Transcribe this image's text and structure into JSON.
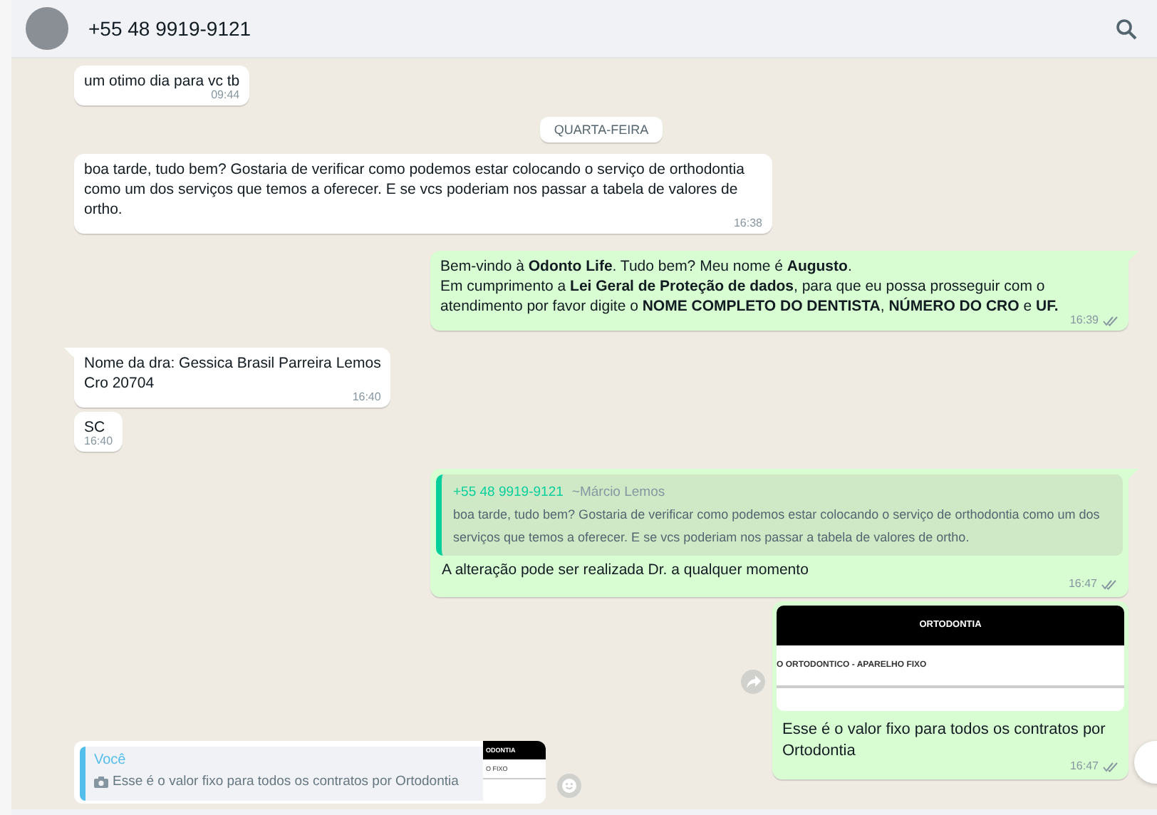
{
  "header": {
    "contact": "+55 48 9919-9121"
  },
  "messages": [
    {
      "kind": "text",
      "outgoing": false,
      "text": "um otimo dia para vc tb",
      "time": "09:44",
      "tail": false
    },
    {
      "kind": "date",
      "text": "QUARTA-FEIRA"
    },
    {
      "kind": "text",
      "outgoing": false,
      "text": "boa tarde, tudo bem? Gostaria de verificar como podemos estar colocando o serviço de orthodontia como um dos serviços que temos a oferecer. E se vcs poderiam nos passar a tabela de valores de ortho.",
      "time": "16:38",
      "tail": false
    },
    {
      "kind": "text",
      "outgoing": true,
      "text": "Bem-vindo à **Odonto Life**. Tudo bem? Meu nome é **Augusto**.\nEm cumprimento a **Lei Geral de Proteção de dados**, para que eu possa prosseguir com o atendimento por favor digite o **NOME COMPLETO DO DENTISTA**, **NÚMERO DO CRO** e **UF.**",
      "time": "16:39",
      "read": false,
      "tail": true
    },
    {
      "kind": "text",
      "outgoing": false,
      "text": "Nome da dra: Gessica Brasil Parreira Lemos\nCro 20704",
      "time": "16:40",
      "tail": true
    },
    {
      "kind": "text",
      "outgoing": false,
      "text": "SC",
      "time": "16:40",
      "tail": false
    },
    {
      "kind": "quote",
      "outgoing": true,
      "quote_author": "+55 48 9919-9121",
      "quote_name": "~Márcio Lemos",
      "quote_text": "boa tarde, tudo bem? Gostaria de verificar como podemos estar colocando o serviço de orthodontia como um dos serviços que temos a oferecer. E se vcs poderiam nos passar a tabela de valores de ortho.",
      "text": "A alteração pode ser realizada Dr. a qualquer momento",
      "time": "16:47",
      "read": false,
      "tail": true
    },
    {
      "kind": "image",
      "outgoing": true,
      "image_title": "ORTODONTIA",
      "image_row": "O ORTODONTICO - APARELHO FIXO",
      "text": "Esse é o valor fixo para todos os contratos por Ortodontia",
      "time": "16:47",
      "read": false,
      "tail": false
    }
  ],
  "reply_preview": {
    "author": "Você",
    "text": "Esse é o valor fixo para todos os contratos por Ortodontia",
    "thumb_title": "ODONTIA",
    "thumb_row": "O FIXO"
  }
}
